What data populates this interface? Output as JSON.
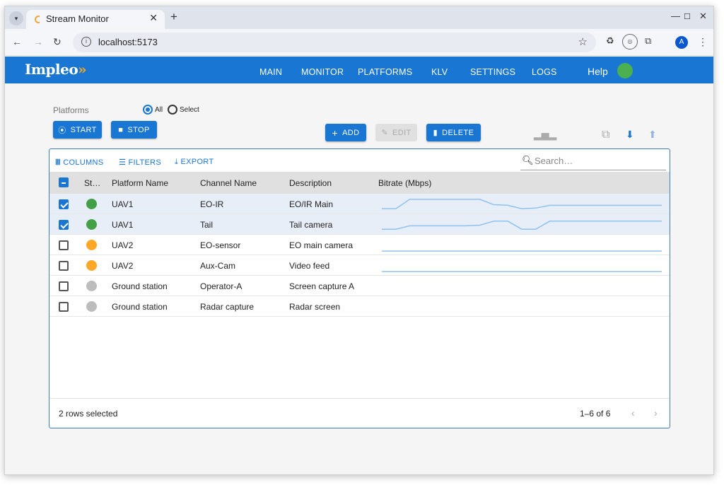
{
  "browser": {
    "tab_title": "Stream Monitor",
    "new_tab": "+",
    "url": "localhost:5173",
    "profile_initial": "A"
  },
  "app": {
    "logo": "Impleo",
    "nav": [
      "MAIN",
      "MONITOR",
      "PLATFORMS",
      "KLV",
      "SETTINGS",
      "LOGS"
    ],
    "help": "Help",
    "status_color": "#4caf50",
    "accent": "#1976d2"
  },
  "filters": {
    "platforms_label": "Platforms",
    "radio_all": "All",
    "radio_select": "Select",
    "selected": "All"
  },
  "toolbar": {
    "start": "START",
    "stop": "STOP",
    "add": "ADD",
    "edit": "EDIT",
    "delete": "DELETE"
  },
  "grid": {
    "columns_label": "COLUMNS",
    "filters_label": "FILTERS",
    "export_label": "EXPORT",
    "search_placeholder": "Search…",
    "headers": [
      "St…",
      "Platform Name",
      "Channel Name",
      "Description",
      "Bitrate (Mbps)"
    ],
    "rows": [
      {
        "checked": true,
        "status": "#43a047",
        "platform": "UAV1",
        "channel": "EO-IR",
        "description": "EO/IR Main",
        "bitrate": [
          0.2,
          0.2,
          0.9,
          0.9,
          0.9,
          0.9,
          0.9,
          0.9,
          0.5,
          0.45,
          0.2,
          0.25,
          0.45,
          0.45,
          0.45,
          0.45,
          0.45,
          0.45,
          0.45,
          0.45,
          0.45
        ]
      },
      {
        "checked": true,
        "status": "#43a047",
        "platform": "UAV1",
        "channel": "Tail",
        "description": "Tail camera",
        "bitrate": [
          0.2,
          0.2,
          0.45,
          0.45,
          0.45,
          0.45,
          0.45,
          0.5,
          0.8,
          0.8,
          0.2,
          0.2,
          0.8,
          0.8,
          0.8,
          0.8,
          0.8,
          0.8,
          0.8,
          0.8,
          0.8
        ]
      },
      {
        "checked": false,
        "status": "#ffa726",
        "platform": "UAV2",
        "channel": "EO-sensor",
        "description": "EO main camera",
        "bitrate": [
          0.1,
          0.1,
          0.1,
          0.1,
          0.1,
          0.1,
          0.1,
          0.1,
          0.1,
          0.1,
          0.1,
          0.1,
          0.1,
          0.1,
          0.1,
          0.1,
          0.1,
          0.1,
          0.1,
          0.1,
          0.1
        ]
      },
      {
        "checked": false,
        "status": "#ffa726",
        "platform": "UAV2",
        "channel": "Aux-Cam",
        "description": "Video feed",
        "bitrate": [
          0.1,
          0.1,
          0.1,
          0.1,
          0.1,
          0.1,
          0.1,
          0.1,
          0.1,
          0.1,
          0.1,
          0.1,
          0.1,
          0.1,
          0.1,
          0.1,
          0.1,
          0.1,
          0.1,
          0.1,
          0.1
        ]
      },
      {
        "checked": false,
        "status": "#bdbdbd",
        "platform": "Ground station",
        "channel": "Operator-A",
        "description": "Screen capture A",
        "bitrate": []
      },
      {
        "checked": false,
        "status": "#bdbdbd",
        "platform": "Ground station",
        "channel": "Radar capture",
        "description": "Radar screen",
        "bitrate": []
      }
    ],
    "footer_selected": "2 rows selected",
    "pagination": "1–6 of 6"
  }
}
